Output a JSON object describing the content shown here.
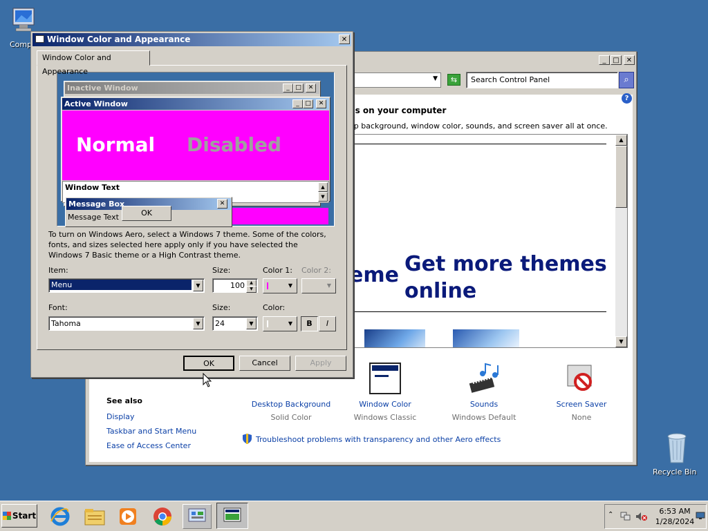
{
  "desktop": {
    "computer_icon_label": "Comp",
    "recycle_bin_label": "Recycle Bin"
  },
  "control_panel": {
    "search_placeholder": "Search Control Panel",
    "heading": "ds on your computer",
    "subheading": "op background, window color, sounds, and screen saver all at once.",
    "theme_partial": "eme",
    "get_more_themes_line1": "Get more themes",
    "get_more_themes_line2": "online",
    "bottom_items": [
      {
        "label": "Desktop Background",
        "value": "Solid Color"
      },
      {
        "label": "Window Color",
        "value": "Windows Classic"
      },
      {
        "label": "Sounds",
        "value": "Windows Default"
      },
      {
        "label": "Screen Saver",
        "value": "None"
      }
    ],
    "see_also": {
      "title": "See also",
      "links": [
        "Display",
        "Taskbar and Start Menu",
        "Ease of Access Center"
      ]
    },
    "troubleshoot_link": "Troubleshoot problems with transparency and other Aero effects"
  },
  "dialog": {
    "title": "Window Color and Appearance",
    "tab_label": "Window Color and Appearance",
    "preview": {
      "inactive_title": "Inactive Window",
      "active_title": "Active Window",
      "normal_text": "Normal",
      "disabled_text": "Disabled",
      "window_text": "Window Text",
      "message_box_title": "Message Box",
      "message_text": "Message Text",
      "ok_label": "OK"
    },
    "description": "To turn on Windows Aero, select a Windows 7 theme.  Some of the colors, fonts, and sizes selected here apply only if you have selected the Windows 7 Basic theme or a High Contrast theme.",
    "item_label": "Item:",
    "item_value": "Menu",
    "size_label": "Size:",
    "size_value": "100",
    "color1_label": "Color 1:",
    "color2_label": "Color 2:",
    "font_label": "Font:",
    "font_value": "Tahoma",
    "font_size_label": "Size:",
    "font_size_value": "24",
    "font_color_label": "Color:",
    "bold_label": "B",
    "italic_label": "I",
    "ok_button": "OK",
    "cancel_button": "Cancel",
    "apply_button": "Apply"
  },
  "taskbar": {
    "start_label": "Start",
    "clock_time": "6:53 AM",
    "clock_date": "1/28/2024"
  },
  "colors": {
    "desktop": "#3a6ea5",
    "title_active_start": "#0a246a",
    "title_active_end": "#a6caf0",
    "preview_window_bg": "#ff00ff",
    "highlight": "#0a246a",
    "link": "#0a3fa6",
    "themes_heading": "#0a1a7a"
  }
}
